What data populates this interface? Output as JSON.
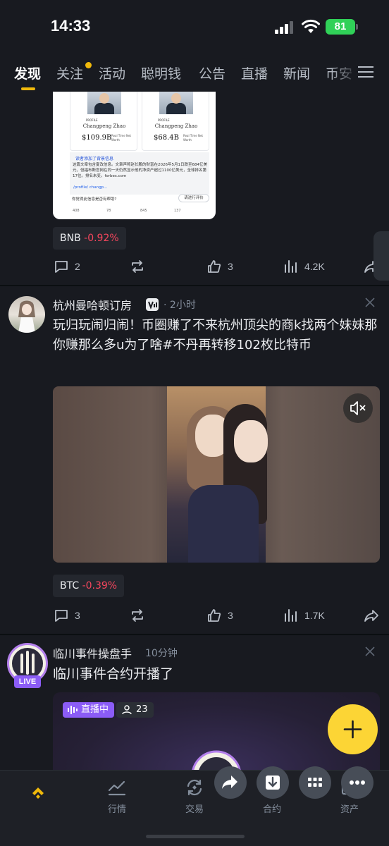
{
  "status_bar": {
    "time": "14:33",
    "battery": "81"
  },
  "tabs": [
    {
      "label": "发现",
      "active": true
    },
    {
      "label": "关注",
      "has_dot": true
    },
    {
      "label": "活动"
    },
    {
      "label": "聪明钱"
    },
    {
      "label": "公告"
    },
    {
      "label": "直播"
    },
    {
      "label": "新闻"
    },
    {
      "label": "币安"
    }
  ],
  "post1": {
    "card": {
      "profile_tag": "PROFILE",
      "left_name": "Changpeng Zhao",
      "left_worth": "$109.9B",
      "right_name": "Changpeng Zhao",
      "right_worth": "$68.4B",
      "realtime_label": "Real Time Net Worth",
      "notice_title": "读者添加了背景信息",
      "notice_body": "这篇文章包含夏改信息。文章声称赵长鹏的财富在2026年5月1日跌至684亿美元，但福布斯官网在同一天仍然显示他的净资产超过1100亿美元，全球排名第17位。排名未变。forbes.com",
      "link": "/profile/ changp...",
      "helpful_question": "你觉得此信息是否有帮助?",
      "rate_button": "请进行评价",
      "stats": [
        "408",
        "78",
        "845",
        "137"
      ]
    },
    "ticker": {
      "symbol": "BNB",
      "change": "-0.92%"
    },
    "actions": {
      "comments": "2",
      "likes": "3",
      "views": "4.2K"
    }
  },
  "post2": {
    "author": "杭州曼哈顿订房",
    "time": "2小时",
    "text": "玩归玩闹归闹！币圈赚了不来杭州顶尖的商k找两个妹妹那你赚那么多u为了啥#不丹再转移102枚比特币",
    "ticker": {
      "symbol": "BTC",
      "change": "-0.39%"
    },
    "actions": {
      "comments": "3",
      "likes": "3",
      "views": "1.7K"
    }
  },
  "post3": {
    "author": "临川事件操盘手",
    "time": "10分钟",
    "text": "临川事件合约开播了",
    "live_badge": "LIVE",
    "live_tag": "直播中",
    "viewers": "23"
  },
  "bottom_nav": [
    {
      "label": "",
      "icon": "binance-home-icon"
    },
    {
      "label": "行情",
      "icon": "market-chart-icon"
    },
    {
      "label": "交易",
      "icon": "trade-swap-icon"
    },
    {
      "label": "合约",
      "icon": "futures-icon"
    },
    {
      "label": "资产",
      "icon": "wallet-icon"
    }
  ],
  "colors": {
    "accent": "#F0B90B",
    "down": "#F6465D",
    "live": "#8B5CF6",
    "background": "#181A20"
  }
}
